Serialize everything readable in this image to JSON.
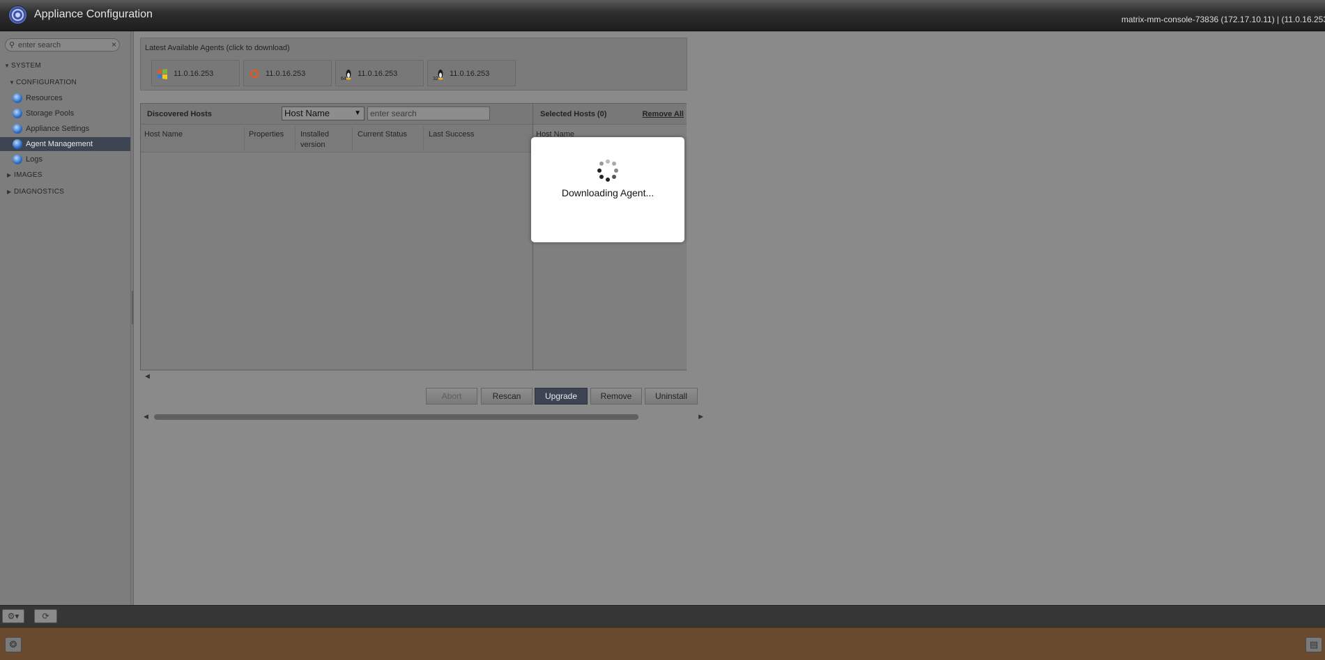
{
  "header": {
    "app_title": "Appliance Configuration",
    "host_info": "matrix-mm-console-73836 (172.17.10.11) | (11.0.16.253"
  },
  "sidebar": {
    "search_placeholder": "enter search",
    "clear_symbol": "×",
    "sections": {
      "system": "SYSTEM",
      "configuration": "CONFIGURATION",
      "images": "IMAGES",
      "diagnostics": "DIAGNOSTICS"
    },
    "items": [
      {
        "label": "Resources"
      },
      {
        "label": "Storage Pools"
      },
      {
        "label": "Appliance Settings"
      },
      {
        "label": "Agent Management",
        "active": true
      },
      {
        "label": "Logs"
      }
    ]
  },
  "agents": {
    "title": "Latest Available Agents (click to download)",
    "tiles": [
      {
        "icon": "windows-icon",
        "version": "11.0.16.253"
      },
      {
        "icon": "ubuntu-icon",
        "version": "11.0.16.253"
      },
      {
        "icon": "linux-64-icon",
        "badge": "64",
        "version": "11.0.16.253"
      },
      {
        "icon": "linux-32-icon",
        "badge": "32",
        "version": "11.0.16.253"
      }
    ]
  },
  "discovered_hosts": {
    "title": "Discovered Hosts",
    "filter_selected": "Host Name",
    "search_placeholder": "enter search",
    "columns": [
      "Host Name",
      "Properties",
      "Installed version",
      "Current Status",
      "Last Success"
    ]
  },
  "selected_hosts": {
    "title": "Selected Hosts (0)",
    "remove_all": "Remove All",
    "column": "Host Name"
  },
  "actions": {
    "abort": "Abort",
    "rescan": "Rescan",
    "upgrade": "Upgrade",
    "remove": "Remove",
    "uninstall": "Uninstall"
  },
  "modal": {
    "message": "Downloading Agent..."
  },
  "colors": {
    "active_item": "#3e4552",
    "primary_button": "#3c4453",
    "status_bar": "#6a4a2f",
    "overlay_gray": "#8a8a8a"
  }
}
